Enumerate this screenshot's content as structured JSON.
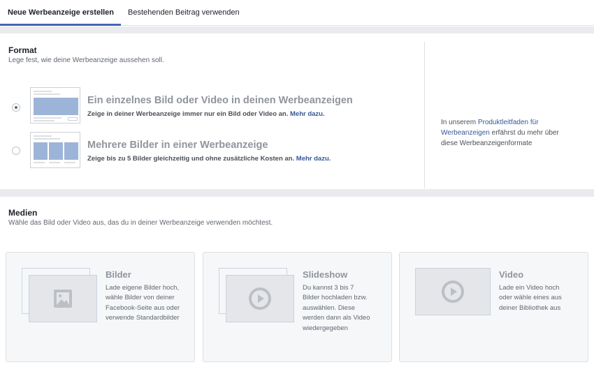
{
  "tabs": {
    "active": "Neue Werbeanzeige erstellen",
    "inactive": "Bestehenden Beitrag verwenden"
  },
  "format": {
    "title": "Format",
    "subtitle": "Lege fest, wie deine Werbeanzeige aussehen soll.",
    "options": [
      {
        "title": "Ein einzelnes Bild oder Video in deinen Werbeanzeigen",
        "desc": "Zeige in deiner Werbeanzeige immer nur ein Bild oder Video an.",
        "link": "Mehr dazu.",
        "selected": true
      },
      {
        "title": "Mehrere Bilder in einer Werbeanzeige",
        "desc": "Zeige bis zu 5 Bilder gleichzeitig und ohne zusätzliche Kosten an.",
        "link": "Mehr dazu.",
        "selected": false
      }
    ],
    "side_note": {
      "prefix": "In unserem ",
      "link": "Produktleitfaden für Werbeanzeigen",
      "suffix": " erfährst du mehr über diese Werbeanzeigenformate"
    }
  },
  "media": {
    "title": "Medien",
    "subtitle": "Wähle das Bild oder Video aus, das du in deiner Werbeanzeige verwenden möchtest.",
    "cards": [
      {
        "title": "Bilder",
        "desc": "Lade eigene Bilder hoch, wähle Bilder von deiner Facebook-Seite aus oder verwende Standardbilder",
        "icon": "image-icon"
      },
      {
        "title": "Slideshow",
        "desc": "Du kannst 3 bis 7 Bilder hochladen bzw. auswählen. Diese werden dann als Video wiedergegeben",
        "icon": "play-icon"
      },
      {
        "title": "Video",
        "desc": "Lade ein Video hoch oder wähle eines aus deiner Bibliothek aus",
        "icon": "play-icon"
      }
    ]
  },
  "colors": {
    "accent": "#4267b2",
    "link": "#365899",
    "background_band": "#e9ebee"
  }
}
